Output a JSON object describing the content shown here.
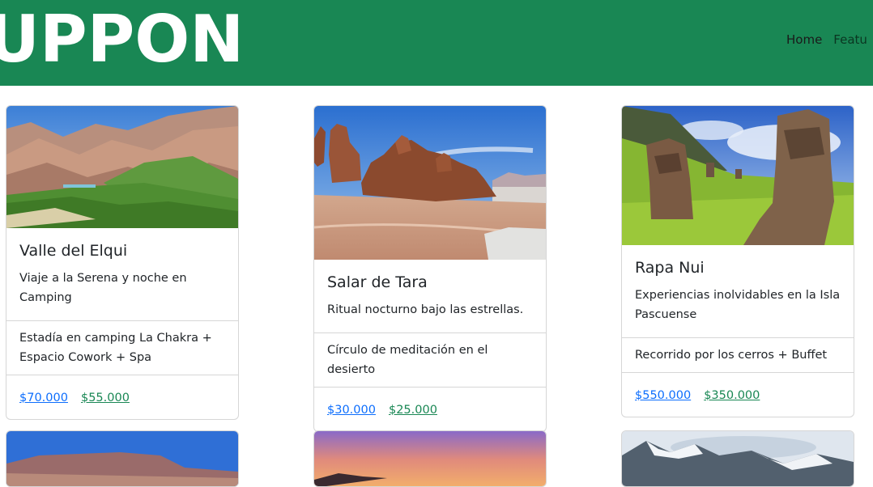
{
  "header": {
    "brand": "UPPON",
    "nav": [
      "Home",
      "Featu"
    ]
  },
  "cards": [
    {
      "title": "Valle del Elqui",
      "text": "Viaje a la Serena y noche en Camping",
      "item": "Estadía en camping La Chakra + Espacio Cowork + Spa",
      "price_original": "$70.000",
      "price_offer": "$55.000"
    },
    {
      "title": "Salar de Tara",
      "text": "Ritual nocturno bajo las estrellas.",
      "item": "Círculo de meditación en el desierto",
      "price_original": "$30.000",
      "price_offer": "$25.000"
    },
    {
      "title": "Rapa Nui",
      "text": "Experiencias inolvidables en la Isla Pascuense",
      "item": "Recorrido por los cerros + Buffet",
      "price_original": "$550.000",
      "price_offer": "$350.000"
    }
  ],
  "colors": {
    "header_bg": "#198754",
    "link_blue": "#0d6efd",
    "link_green": "#198754"
  }
}
